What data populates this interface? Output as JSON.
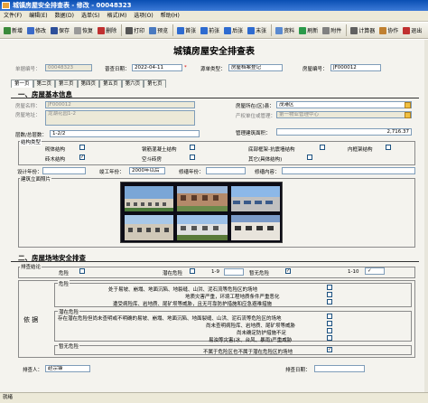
{
  "window": {
    "title": "城镇房屋安全排查表 - 修改 - 00048323"
  },
  "menu": [
    "文件(F)",
    "编辑(E)",
    "数据(D)",
    "选单(S)",
    "格式(M)",
    "选项(O)",
    "帮助(H)"
  ],
  "toolbar": [
    {
      "label": "新增",
      "icon": "new-icon",
      "color": "#3a8a3a"
    },
    {
      "label": "修改",
      "icon": "edit-icon",
      "color": "#3a6ac8"
    },
    {
      "label": "保存",
      "icon": "save-icon",
      "color": "#2d4f9a"
    },
    {
      "label": "恢复",
      "icon": "undo-icon",
      "color": "#999999"
    },
    {
      "label": "删除",
      "icon": "delete-icon",
      "color": "#c03030"
    },
    {
      "label": "打印",
      "icon": "print-icon",
      "color": "#555555"
    },
    {
      "label": "预览",
      "icon": "preview-icon",
      "color": "#4a7ac0"
    },
    {
      "label": "首张",
      "icon": "first-icon",
      "color": "#2e6bd0"
    },
    {
      "label": "前张",
      "icon": "prev-icon",
      "color": "#2e6bd0"
    },
    {
      "label": "后张",
      "icon": "next-icon",
      "color": "#2e6bd0"
    },
    {
      "label": "末张",
      "icon": "last-icon",
      "color": "#2e6bd0"
    },
    {
      "label": "资料",
      "icon": "data-icon",
      "color": "#5a8ad0"
    },
    {
      "label": "刷新",
      "icon": "refresh-icon",
      "color": "#2a9a4a"
    },
    {
      "label": "附件",
      "icon": "attach-icon",
      "color": "#808080"
    },
    {
      "label": "计算器",
      "icon": "calculator-icon",
      "color": "#606060"
    },
    {
      "label": "协作",
      "icon": "collab-icon",
      "color": "#c08030"
    },
    {
      "label": "退出",
      "icon": "exit-icon",
      "color": "#c03030"
    }
  ],
  "form": {
    "title": "城镇房屋安全排查表",
    "doc_no_label": "单据编号：",
    "doc_no": "00048323",
    "check_date_label": "普查日期：",
    "check_date": "2022-04-11",
    "source_type_label": "源单类型：",
    "source_type": "房屋档案登记",
    "house_no_label": "房屋编号：",
    "house_no": "JF000012"
  },
  "tabs": [
    "第一页",
    "第二页",
    "第三页",
    "第四页",
    "第五页",
    "第六页",
    "第七页"
  ],
  "basic": {
    "section": "一、房屋基本信息",
    "name_label": "房屋名称：",
    "name_value": "JF000012",
    "addr_label": "房屋地址：",
    "addr_value": "龙湖花园1-2",
    "district_label": "房屋所在(区)县：",
    "district_value": "茂港区",
    "unit_label": "产权单位或管理：",
    "unit_value": "第一物业管理中心",
    "floors_label": "层数/总层数：",
    "floors_value": "1-2/2",
    "area_label": "管理建筑面积：",
    "area_value": "2,716.37",
    "struct_group": "结构类型",
    "struct_options": [
      "砌体结构",
      "钢筋混凝土结构",
      "底部框架-抗震墙结构",
      "内框架结构",
      "砖木结构",
      "空斗砖房",
      "其它(具体结构)"
    ],
    "design_year_label": "设计年份：",
    "design_year": "",
    "build_year_label": "竣工年份：",
    "build_year": "2000年以后",
    "repair_year_label": "修缮年份：",
    "repair_year": "",
    "repair_content_label": "修缮内容：",
    "repair_content": "",
    "photo_label": "建筑立面照片"
  },
  "safety": {
    "section": "二、房屋场地安全排查",
    "conclusion_group": "排查结论",
    "danger_label": "危险",
    "potential_label": "潜在危险",
    "range1": "1-9",
    "none_label": "暂无危险",
    "range2": "1-10",
    "basis_label": "依  据",
    "danger_group": "危险",
    "danger_items": [
      "处于易坡、崩塌、地面沉陷、地裂缝、山洪、泥石流等危险区的场地",
      "地质灾害严重，环境工程地质条件严重恶化",
      "遭受病险库、岩地质、尾矿坝等威胁，且无可靠防护措施和应急避难措施"
    ],
    "potential_group": "潜在危险",
    "potential_items": [
      "存在潜在危险但尚未查明或不明确的易坡、崩塌、地面沉陷、地面裂缝、山洪、泥石流等危险区的场地",
      "尚未查明病险库、岩地质、尾矿坝等威胁",
      "尚未确定防护措施不足",
      "易浊等灾害(冰、台风、暴雨)严重威胁"
    ],
    "none_group": "暂无危险",
    "none_item": "不属于危险区也不属于潜在危险区的场地",
    "inspector_label": "排查人：",
    "inspector": "赵宗锋",
    "inspect_date_label": "排查日期："
  },
  "status": {
    "text": "就绪"
  }
}
